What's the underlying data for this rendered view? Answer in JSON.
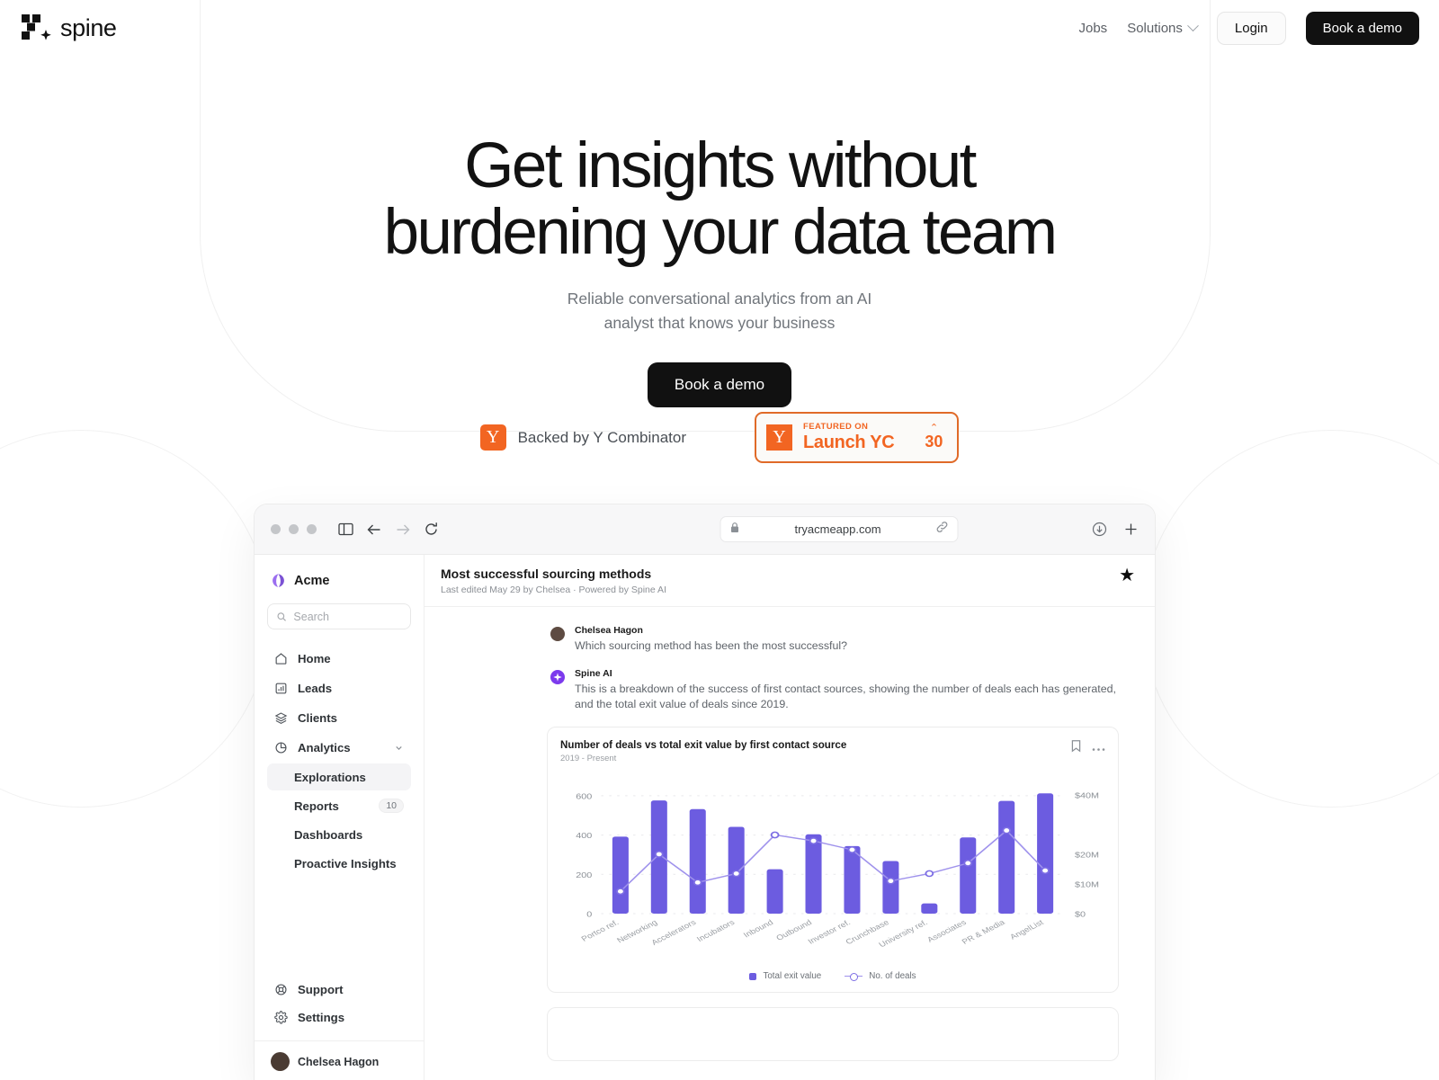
{
  "header": {
    "brand": "spine",
    "nav": [
      {
        "label": "Jobs",
        "type": "link"
      },
      {
        "label": "Solutions",
        "type": "dropdown"
      }
    ],
    "login_label": "Login",
    "demo_label": "Book a demo"
  },
  "hero": {
    "title_line1": "Get insights without",
    "title_line2": "burdening your data team",
    "sub_line1": "Reliable conversational analytics from an AI",
    "sub_line2": "analyst that knows your business",
    "cta_label": "Book a demo"
  },
  "yc": {
    "backed_label": "Backed by Y Combinator",
    "y_glyph": "Y",
    "featured_on": "FEATURED ON",
    "launch_label": "Launch YC",
    "vote_count": "30",
    "caret": "⌃",
    "orange": "#f26522"
  },
  "browser": {
    "url": "tryacmeapp.com",
    "lock_icon": "lock-icon",
    "back_icon": "back-arrow-icon",
    "forward_icon": "forward-arrow-icon",
    "reload_icon": "reload-icon",
    "sidebar_toggle_icon": "sidebar-toggle-icon",
    "link_icon": "link-icon",
    "download_icon": "download-icon",
    "newtab_icon": "plus-icon"
  },
  "app": {
    "workspace": "Acme",
    "search_placeholder": "Search",
    "search_value": "",
    "nav": [
      {
        "label": "Home",
        "icon": "home-icon"
      },
      {
        "label": "Leads",
        "icon": "bar-chart-icon"
      },
      {
        "label": "Clients",
        "icon": "layers-icon"
      },
      {
        "label": "Analytics",
        "icon": "pie-chart-icon",
        "expanded": true
      }
    ],
    "analytics_children": [
      {
        "label": "Explorations",
        "active": true,
        "badge": ""
      },
      {
        "label": "Reports",
        "active": false,
        "badge": "10"
      },
      {
        "label": "Dashboards",
        "active": false,
        "badge": ""
      },
      {
        "label": "Proactive Insights",
        "active": false,
        "badge": ""
      }
    ],
    "bottom_nav": [
      {
        "label": "Support",
        "icon": "lifebuoy-icon"
      },
      {
        "label": "Settings",
        "icon": "gear-icon"
      }
    ],
    "user_name": "Chelsea Hagon"
  },
  "doc": {
    "title": "Most successful sourcing methods",
    "meta": "Last edited May 29 by Chelsea  ·  Powered by Spine AI",
    "star_icon": "star-filled-icon"
  },
  "conversation": [
    {
      "author": "Chelsea Hagon",
      "role": "user",
      "text": "Which sourcing method has been the most successful?"
    },
    {
      "author": "Spine AI",
      "role": "ai",
      "text": "This is a breakdown of the success of first contact sources, showing the number of deals each has generated, and the total exit value of deals since 2019."
    }
  ],
  "card": {
    "bookmark_icon": "bookmark-icon",
    "more_icon": "more-horizontal-icon"
  },
  "chart_data": {
    "type": "bar",
    "title": "Number of deals vs total exit value by first contact source",
    "subtitle": "2019 - Present",
    "categories": [
      "Portco ref.",
      "Networking",
      "Accelerators",
      "Incubators",
      "Inbound",
      "Outbound",
      "Investor ref.",
      "Crunchbase",
      "University ref.",
      "Associates",
      "PR & Media",
      "AngelList"
    ],
    "series": [
      {
        "name": "Total exit value",
        "type": "bar",
        "axis": "left",
        "values": [
          392,
          576,
          532,
          442,
          226,
          404,
          344,
          268,
          52,
          388,
          574,
          612
        ]
      },
      {
        "name": "No. of deals",
        "type": "line",
        "axis": "right",
        "values": [
          7.5,
          20.0,
          10.5,
          13.5,
          26.5,
          24.5,
          21.5,
          11.0,
          13.5,
          17.0,
          28.0,
          14.5
        ]
      }
    ],
    "left_axis": {
      "label": "",
      "ticks": [
        "0",
        "200",
        "400",
        "600"
      ],
      "min": 0,
      "max": 650
    },
    "right_axis": {
      "label": "",
      "ticks": [
        "$0",
        "$10M",
        "$20M",
        "$40M"
      ],
      "min": 0,
      "max": 43
    },
    "grid": true,
    "legend_position": "bottom",
    "bar_color": "#6c5ce0",
    "line_color": "#9f92ec"
  }
}
